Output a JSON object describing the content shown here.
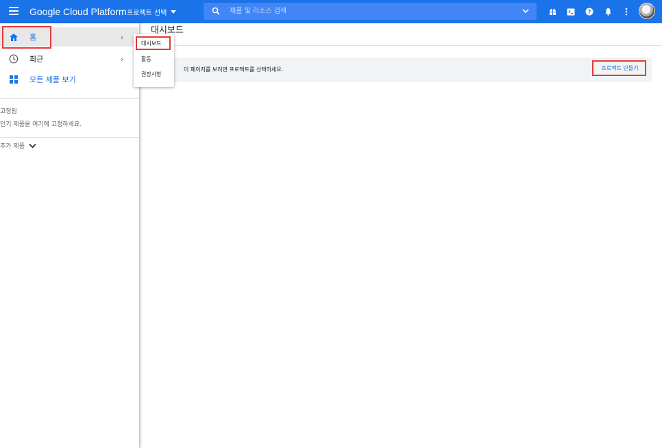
{
  "header": {
    "brand": "Google Cloud Platform",
    "project_select": "프로젝트 선택",
    "search_placeholder": "제품 및 리소스 검색",
    "icons": [
      "gift-icon",
      "terminal-icon",
      "help-icon",
      "bell-icon",
      "more-vert-icon"
    ]
  },
  "sidebar": {
    "items": [
      {
        "label": "홈",
        "icon": "home-icon"
      },
      {
        "label": "최근",
        "icon": "clock-icon"
      },
      {
        "label": "모든 제품 보기",
        "icon": "grid-icon"
      }
    ],
    "pinned_title": "고정됨",
    "pinned_hint": "인기 제품을 여기에 고정하세요.",
    "more_products": "추가 제품"
  },
  "flyout": {
    "items": [
      "대시보드",
      "활동",
      "권장사항"
    ]
  },
  "main": {
    "title": "대시보드",
    "banner_text": "이 페이지를 보려면 프로젝트를 선택하세요.",
    "create_project": "프로젝트 만들기"
  },
  "colors": {
    "brand_blue": "#1a73e8",
    "highlight_red": "#e53935"
  }
}
